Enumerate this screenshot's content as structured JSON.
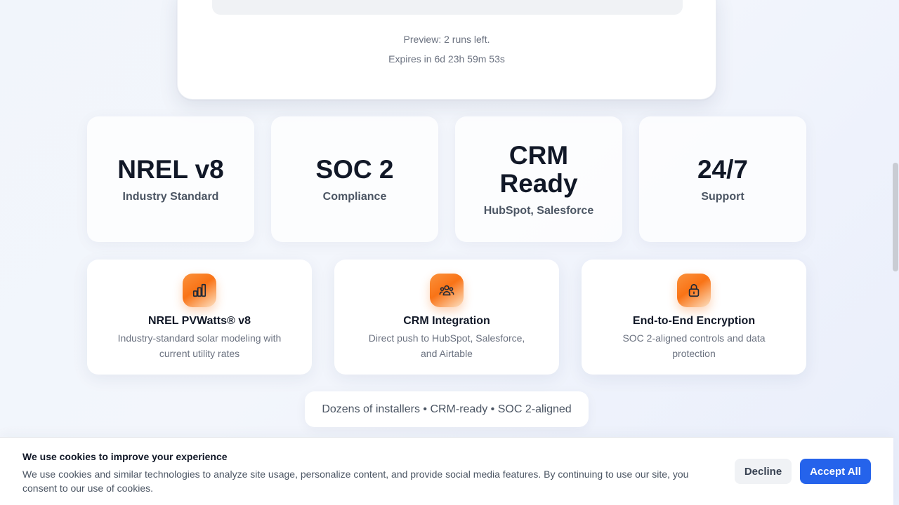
{
  "preview": {
    "runs_left": "Preview: 2 runs left.",
    "expires": "Expires in 6d 23h 59m 53s"
  },
  "stats": [
    {
      "value": "NREL v8",
      "label": "Industry Standard"
    },
    {
      "value": "SOC 2",
      "label": "Compliance"
    },
    {
      "value": "CRM Ready",
      "label": "HubSpot, Salesforce"
    },
    {
      "value": "24/7",
      "label": "Support"
    }
  ],
  "features": [
    {
      "icon": "chart-bars-icon",
      "title": "NREL PVWatts® v8",
      "description": "Industry-standard solar modeling with current utility rates"
    },
    {
      "icon": "users-group-icon",
      "title": "CRM Integration",
      "description": "Direct push to HubSpot, Salesforce, and Airtable"
    },
    {
      "icon": "lock-icon",
      "title": "End-to-End Encryption",
      "description": "SOC 2-aligned controls and data protection"
    }
  ],
  "trust_line": "Dozens of installers • CRM-ready • SOC 2-aligned",
  "cookie_banner": {
    "title": "We use cookies to improve your experience",
    "text": "We use cookies and similar technologies to analyze site usage, personalize content, and provide social media features. By continuing to use our site, you consent to our use of cookies.",
    "decline_label": "Decline",
    "accept_label": "Accept All"
  },
  "colors": {
    "accent_orange": "#f97316",
    "primary_blue": "#2563eb",
    "heading": "#111827",
    "muted": "#6b7280"
  }
}
